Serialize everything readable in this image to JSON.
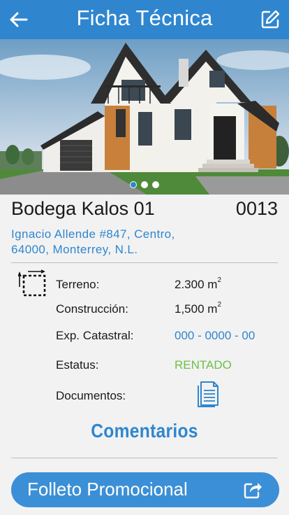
{
  "header": {
    "title": "Ficha Técnica",
    "back_icon": "arrow-left-icon",
    "edit_icon": "edit-icon",
    "color": "#2f86cf"
  },
  "carousel": {
    "image": "house-photo",
    "dots": 3,
    "active_dot": 1
  },
  "property": {
    "name": "Bodega Kalos 01",
    "code": "0013",
    "address_line1": "Ignacio Allende #847, Centro,",
    "address_line2": "64000, Monterrey, N.L."
  },
  "details": {
    "area_icon": "area-measure-icon",
    "terreno_label": "Terreno:",
    "terreno_value": "2.300 m",
    "construccion_label": "Construcción:",
    "construccion_value": "1,500 m",
    "unit_exponent": "2",
    "catastral_label": "Exp. Catastral:",
    "catastral_value": "000 - 0000 - 00",
    "estatus_label": "Estatus:",
    "estatus_value": "RENTADO",
    "documentos_label": "Documentos:",
    "documentos_icon": "document-icon"
  },
  "comments_label": "Comentarios",
  "folleto": {
    "label": "Folleto Promocional",
    "icon": "share-icon"
  }
}
